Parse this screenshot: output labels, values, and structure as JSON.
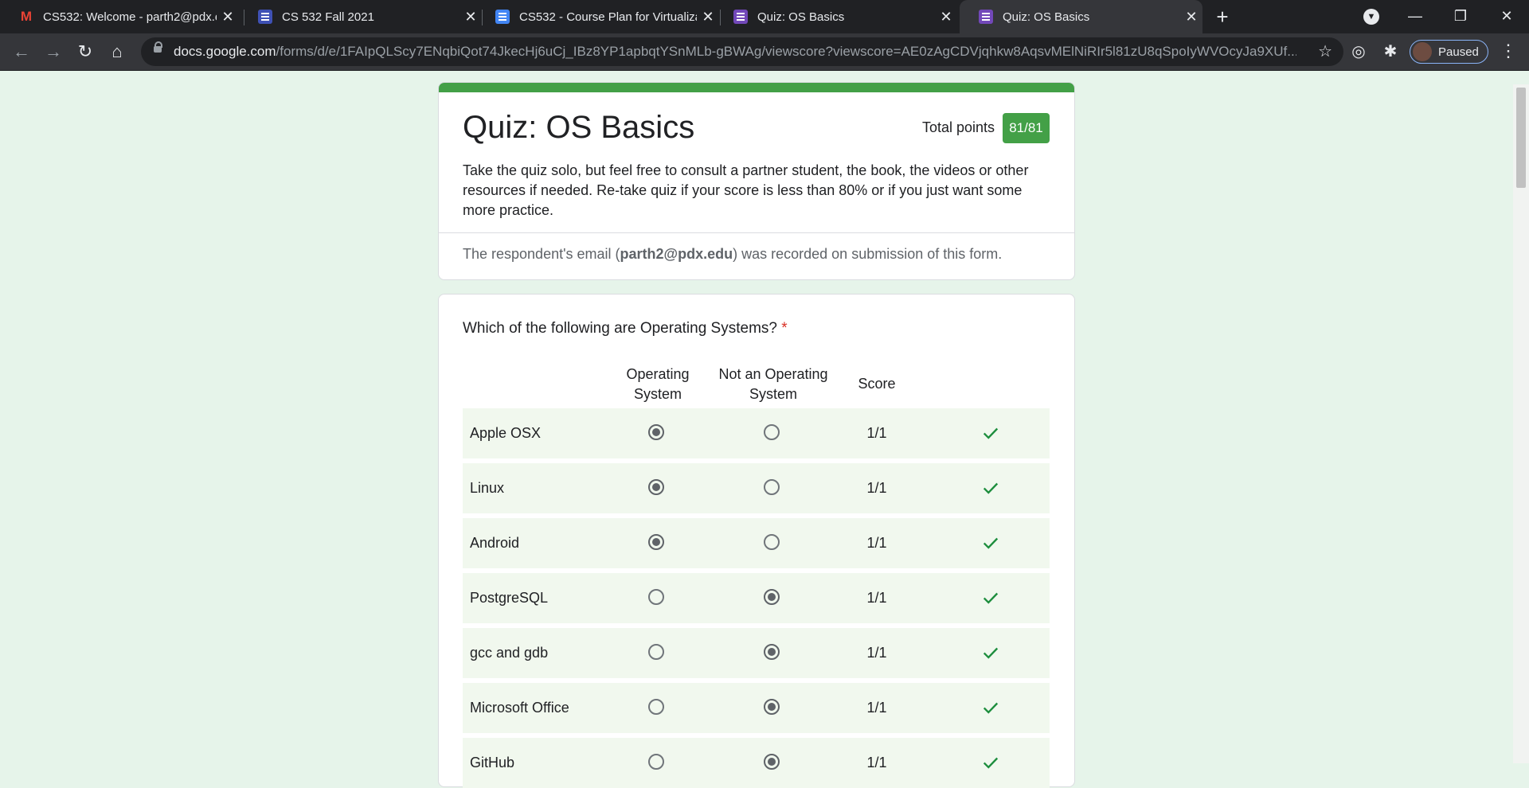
{
  "browser": {
    "tabs": [
      {
        "title": "CS532: Welcome - parth2@pdx.e",
        "favicon": "gmail-icon"
      },
      {
        "title": "CS 532 Fall 2021",
        "favicon": "sites-icon"
      },
      {
        "title": "CS532 - Course Plan for Virtualiza",
        "favicon": "docs-icon"
      },
      {
        "title": "Quiz: OS Basics",
        "favicon": "forms-icon"
      },
      {
        "title": "Quiz: OS Basics",
        "favicon": "forms-icon",
        "active": true
      }
    ],
    "url_host": "docs.google.com",
    "url_path": "/forms/d/e/1FAIpQLScy7ENqbiQot74JkecHj6uCj_IBz8YP1apbqtYSnMLb-gBWAg/viewscore?viewscore=AE0zAgCDVjqhkw8AqsvMElNiRIr5l81zU8qSpoIyWVOcyJa9XUf...",
    "profile_status": "Paused"
  },
  "quiz": {
    "title": "Quiz: OS Basics",
    "total_points_label": "Total points",
    "total_points": "81/81",
    "description": "Take the quiz solo, but feel free to consult a partner student, the book, the videos or other resources if needed. Re-take quiz if your score is less than 80% or if you just want some more practice.",
    "email_prefix": "The respondent's email (",
    "email": "parth2@pdx.edu",
    "email_suffix": ") was recorded on submission of this form."
  },
  "question": {
    "text": "Which of the following are Operating Systems?",
    "required_mark": "*",
    "columns": [
      "Operating System",
      "Not an Operating System",
      "Score"
    ],
    "rows": [
      {
        "label": "Apple OSX",
        "selected": 0,
        "score": "1/1",
        "correct": true
      },
      {
        "label": "Linux",
        "selected": 0,
        "score": "1/1",
        "correct": true
      },
      {
        "label": "Android",
        "selected": 0,
        "score": "1/1",
        "correct": true
      },
      {
        "label": "PostgreSQL",
        "selected": 1,
        "score": "1/1",
        "correct": true
      },
      {
        "label": "gcc and gdb",
        "selected": 1,
        "score": "1/1",
        "correct": true
      },
      {
        "label": "Microsoft Office",
        "selected": 1,
        "score": "1/1",
        "correct": true
      },
      {
        "label": "GitHub",
        "selected": 1,
        "score": "1/1",
        "correct": true
      }
    ]
  },
  "colors": {
    "accent": "#43a047",
    "page_bg": "#e6f4ea",
    "row_bg": "#f1f8ee",
    "check": "#1e8e3e",
    "required": "#d93025"
  }
}
